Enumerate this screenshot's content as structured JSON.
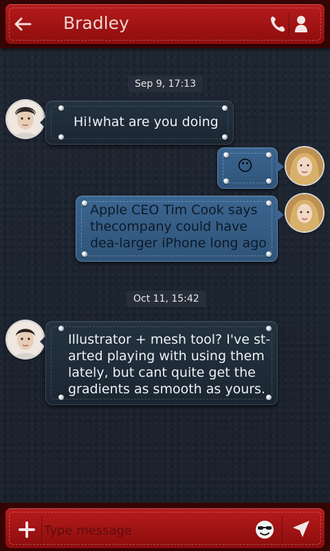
{
  "header": {
    "contact_name": "Bradley",
    "back_icon": "arrow-left-icon",
    "call_icon": "phone-icon",
    "profile_icon": "person-icon"
  },
  "conversation": {
    "date_1": "Sep 9, 17:13",
    "date_2": "Oct 11, 15:42",
    "messages": [
      {
        "direction": "incoming",
        "text": "Hi!what are you doing"
      },
      {
        "direction": "outgoing",
        "text": "😶"
      },
      {
        "direction": "outgoing",
        "text": "Apple CEO Tim Cook says thecompany could have dea-larger iPhone long ago"
      },
      {
        "direction": "incoming",
        "text": "Illustrator + mesh tool? I've st-arted playing with using them lately, but cant quite get the gradients as smooth as yours."
      }
    ],
    "msg2_line1": "Apple CEO Tim Cook says",
    "msg2_line2": "thecompany could have",
    "msg2_line3": "dea-larger iPhone long ago",
    "msg3_line1": "Illustrator + mesh tool? I've st-",
    "msg3_line2": "arted playing with using them",
    "msg3_line3": "lately, but cant quite get the",
    "msg3_line4": "gradients as smooth as yours."
  },
  "composer": {
    "placeholder": "Type message",
    "attach_icon": "plus-icon",
    "emoji_icon": "smiley-sunglasses-icon",
    "send_icon": "send-icon"
  },
  "colors": {
    "bar_red": "#b71b1b",
    "bubble_dark": "#243240",
    "bubble_blue": "#3b6590",
    "background": "#1d2531"
  }
}
